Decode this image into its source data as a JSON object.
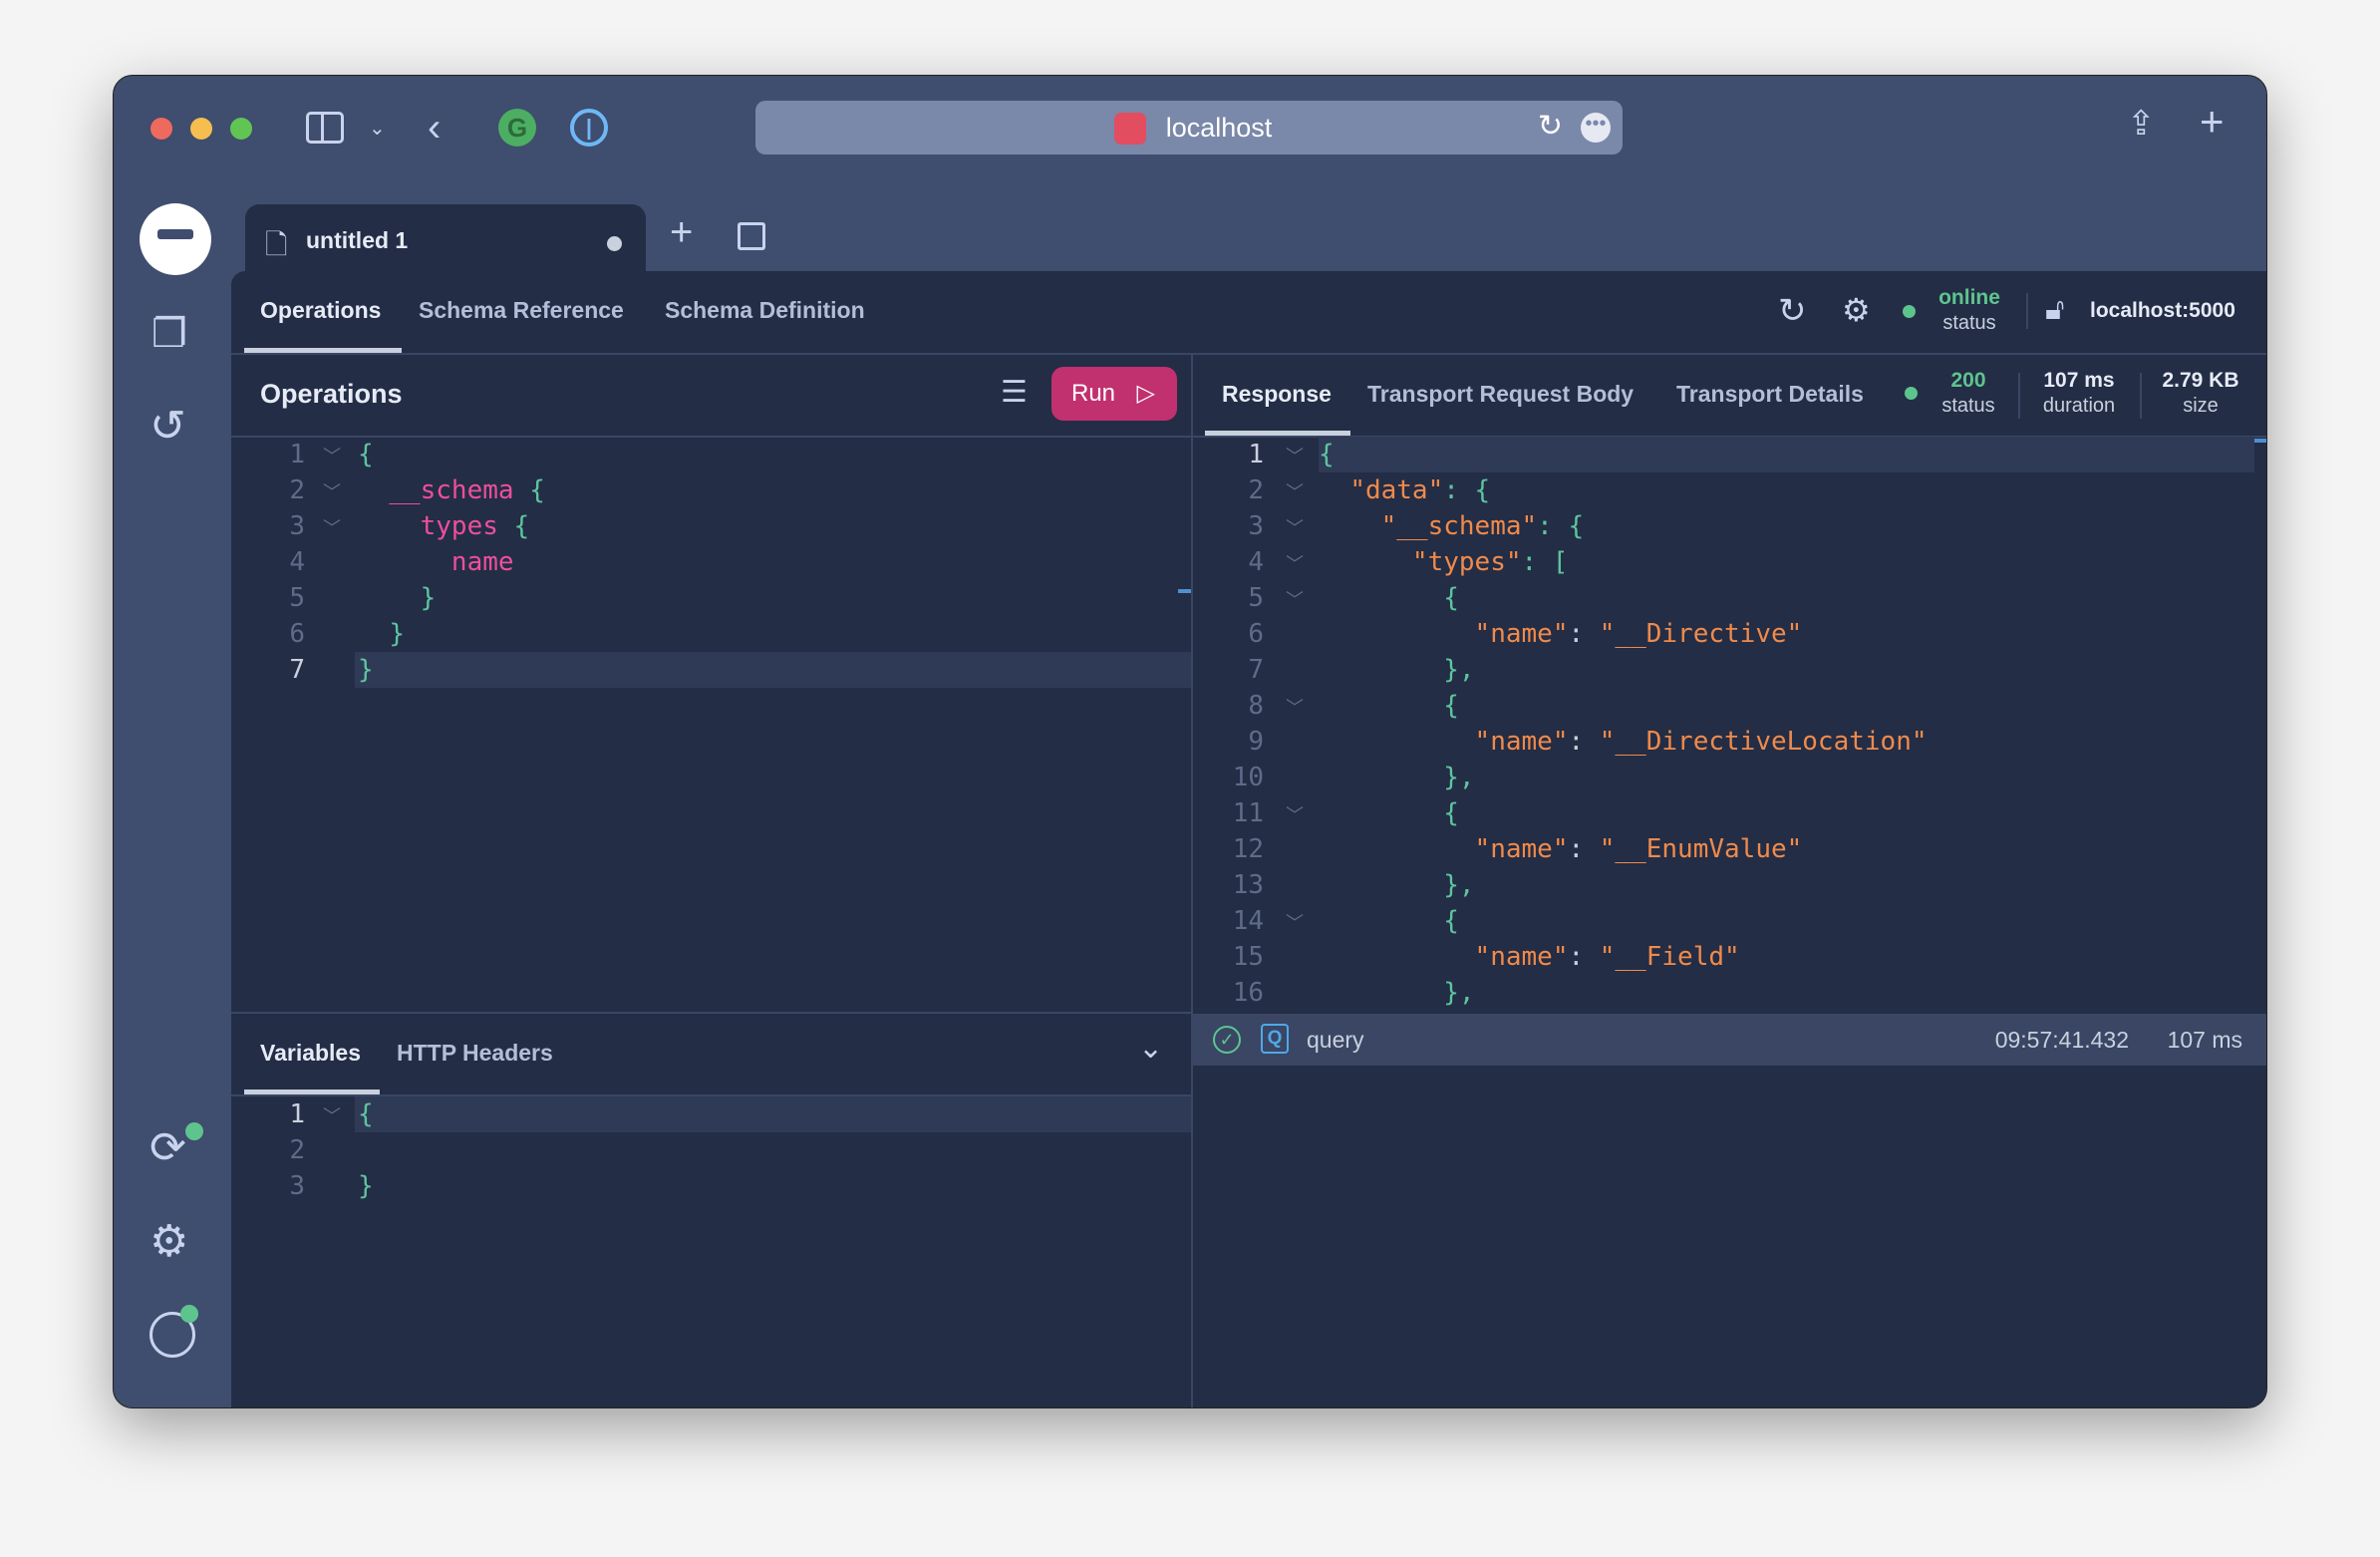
{
  "browser": {
    "address": "localhost",
    "colors": {
      "close": "#ee6a5f",
      "minimize": "#f5be4f",
      "maximize": "#61c554"
    }
  },
  "file_tab": {
    "title": "untitled 1",
    "unsaved": true
  },
  "main_tabs": [
    {
      "label": "Operations",
      "active": true
    },
    {
      "label": "Schema Reference"
    },
    {
      "label": "Schema Definition"
    }
  ],
  "connection": {
    "status_value": "online",
    "status_label": "status",
    "endpoint": "localhost:5000"
  },
  "operations": {
    "title": "Operations",
    "run_label": "Run",
    "lines": [
      [
        [
          "{",
          "p"
        ]
      ],
      [
        [
          "  ",
          ""
        ],
        [
          "__schema",
          "k"
        ],
        [
          " {",
          "p"
        ]
      ],
      [
        [
          "    ",
          ""
        ],
        [
          "types",
          "k"
        ],
        [
          " {",
          "p"
        ]
      ],
      [
        [
          "      ",
          ""
        ],
        [
          "name",
          "k"
        ]
      ],
      [
        [
          "    ",
          ""
        ],
        [
          "}",
          "p"
        ]
      ],
      [
        [
          "  ",
          ""
        ],
        [
          "}",
          "p"
        ]
      ],
      [
        [
          "}",
          "p"
        ]
      ]
    ],
    "folds": [
      1,
      2,
      3
    ]
  },
  "response_tabs": [
    {
      "label": "Response",
      "active": true
    },
    {
      "label": "Transport Request Body"
    },
    {
      "label": "Transport Details"
    }
  ],
  "response_stats": {
    "status": "200",
    "status_label": "status",
    "duration": "107 ms",
    "duration_label": "duration",
    "size": "2.79 KB",
    "size_label": "size"
  },
  "response": {
    "lines": [
      [
        [
          "{",
          "p"
        ]
      ],
      [
        [
          "  ",
          ""
        ],
        [
          "\"data\"",
          "s"
        ],
        [
          ": {",
          "p"
        ]
      ],
      [
        [
          "    ",
          ""
        ],
        [
          "\"__schema\"",
          "s"
        ],
        [
          ": {",
          "p"
        ]
      ],
      [
        [
          "      ",
          ""
        ],
        [
          "\"types\"",
          "s"
        ],
        [
          ": [",
          "p"
        ]
      ],
      [
        [
          "        ",
          ""
        ],
        [
          "{",
          "p"
        ]
      ],
      [
        [
          "          ",
          ""
        ],
        [
          "\"name\"",
          "s"
        ],
        [
          ": ",
          "w"
        ],
        [
          "\"__Directive\"",
          "s"
        ]
      ],
      [
        [
          "        ",
          ""
        ],
        [
          "},",
          "p"
        ]
      ],
      [
        [
          "        ",
          ""
        ],
        [
          "{",
          "p"
        ]
      ],
      [
        [
          "          ",
          ""
        ],
        [
          "\"name\"",
          "s"
        ],
        [
          ": ",
          "w"
        ],
        [
          "\"__DirectiveLocation\"",
          "s"
        ]
      ],
      [
        [
          "        ",
          ""
        ],
        [
          "},",
          "p"
        ]
      ],
      [
        [
          "        ",
          ""
        ],
        [
          "{",
          "p"
        ]
      ],
      [
        [
          "          ",
          ""
        ],
        [
          "\"name\"",
          "s"
        ],
        [
          ": ",
          "w"
        ],
        [
          "\"__EnumValue\"",
          "s"
        ]
      ],
      [
        [
          "        ",
          ""
        ],
        [
          "},",
          "p"
        ]
      ],
      [
        [
          "        ",
          ""
        ],
        [
          "{",
          "p"
        ]
      ],
      [
        [
          "          ",
          ""
        ],
        [
          "\"name\"",
          "s"
        ],
        [
          ": ",
          "w"
        ],
        [
          "\"__Field\"",
          "s"
        ]
      ],
      [
        [
          "        ",
          ""
        ],
        [
          "},",
          "p"
        ]
      ]
    ],
    "folds": [
      1,
      2,
      3,
      4,
      5,
      8,
      11,
      14
    ]
  },
  "history": {
    "type_badge": "Q",
    "operation": "query",
    "time": "09:57:41.432",
    "duration": "107 ms"
  },
  "variables": {
    "tabs": [
      {
        "label": "Variables",
        "active": true
      },
      {
        "label": "HTTP Headers"
      }
    ],
    "lines": [
      [
        [
          "{",
          "p"
        ]
      ],
      [
        [
          "",
          ""
        ]
      ],
      [
        [
          "}",
          "p"
        ]
      ]
    ],
    "folds": [
      1
    ]
  }
}
